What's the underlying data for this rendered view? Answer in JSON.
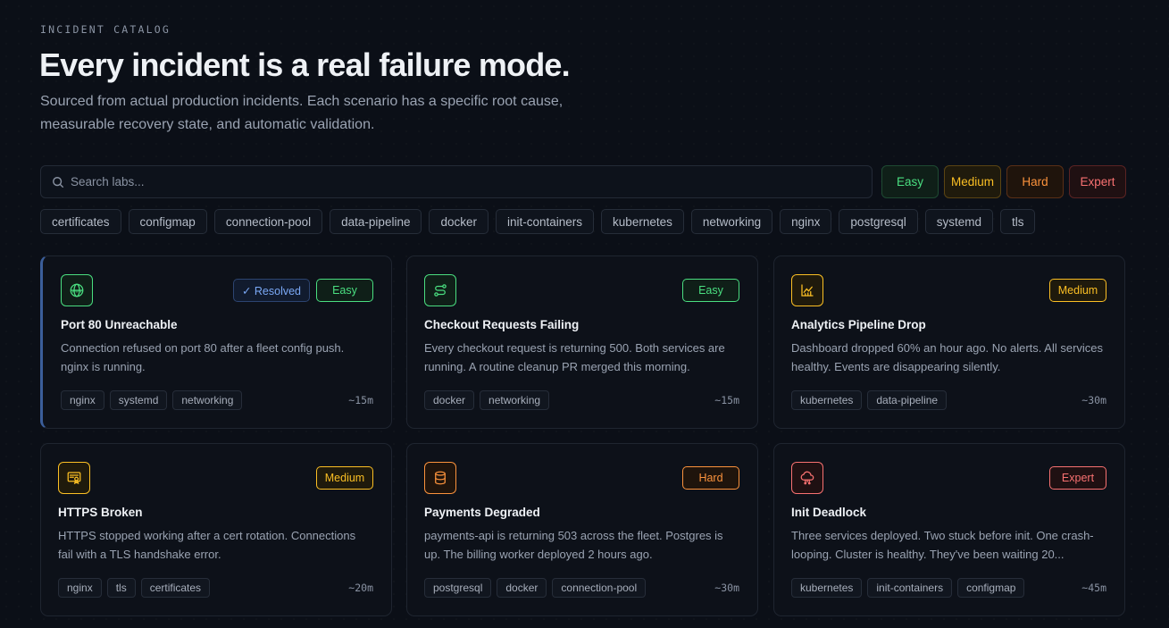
{
  "header": {
    "eyebrow": "INCIDENT CATALOG",
    "title": "Every incident is a real failure mode.",
    "subtitle": "Sourced from actual production incidents. Each scenario has a specific root cause, measurable recovery state, and automatic validation."
  },
  "search": {
    "placeholder": "Search labs...",
    "value": ""
  },
  "difficulty_filters": [
    "Easy",
    "Medium",
    "Hard",
    "Expert"
  ],
  "tag_filters": [
    "certificates",
    "configmap",
    "connection-pool",
    "data-pipeline",
    "docker",
    "init-containers",
    "kubernetes",
    "networking",
    "nginx",
    "postgresql",
    "systemd",
    "tls"
  ],
  "colors": {
    "easy": "#4ade80",
    "medium": "#fbbf24",
    "hard": "#fb923c",
    "expert": "#f87171",
    "resolved": "#7aa8f5"
  },
  "cards": [
    {
      "icon": "globe-icon",
      "status": "✓ Resolved",
      "difficulty": "Easy",
      "title": "Port 80 Unreachable",
      "description": "Connection refused on port 80 after a fleet config push. nginx is running.",
      "tags": [
        "nginx",
        "systemd",
        "networking"
      ],
      "duration": "~15m"
    },
    {
      "icon": "route-icon",
      "difficulty": "Easy",
      "title": "Checkout Requests Failing",
      "description": "Every checkout request is returning 500. Both services are running. A routine cleanup PR merged this morning.",
      "tags": [
        "docker",
        "networking"
      ],
      "duration": "~15m"
    },
    {
      "icon": "chart-icon",
      "difficulty": "Medium",
      "title": "Analytics Pipeline Drop",
      "description": "Dashboard dropped 60% an hour ago. No alerts. All services healthy. Events are disappearing silently.",
      "tags": [
        "kubernetes",
        "data-pipeline"
      ],
      "duration": "~30m"
    },
    {
      "icon": "certificate-icon",
      "difficulty": "Medium",
      "title": "HTTPS Broken",
      "description": "HTTPS stopped working after a cert rotation. Connections fail with a TLS handshake error.",
      "tags": [
        "nginx",
        "tls",
        "certificates"
      ],
      "duration": "~20m"
    },
    {
      "icon": "database-icon",
      "difficulty": "Hard",
      "title": "Payments Degraded",
      "description": "payments-api is returning 503 across the fleet. Postgres is up. The billing worker deployed 2 hours ago.",
      "tags": [
        "postgresql",
        "docker",
        "connection-pool"
      ],
      "duration": "~30m"
    },
    {
      "icon": "cloud-network-icon",
      "difficulty": "Expert",
      "title": "Init Deadlock",
      "description": "Three services deployed. Two stuck before init. One crash-looping. Cluster is healthy. They've been waiting 20...",
      "tags": [
        "kubernetes",
        "init-containers",
        "configmap"
      ],
      "duration": "~45m"
    }
  ]
}
